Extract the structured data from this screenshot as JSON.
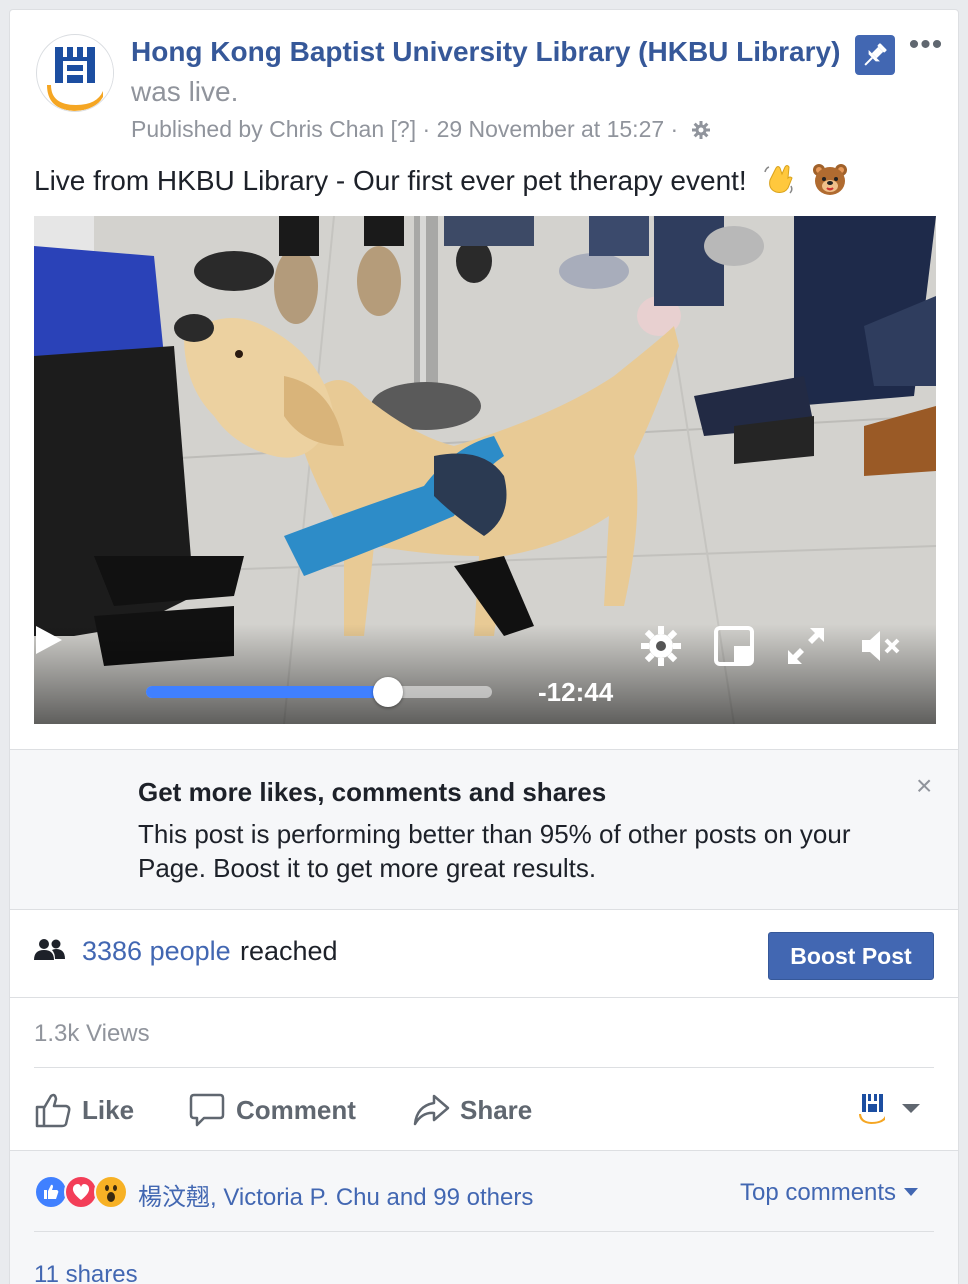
{
  "post": {
    "page_name": "Hong Kong Baptist University Library (HKBU Library)",
    "status": "was live.",
    "published_by": "Published by Chris Chan",
    "help_marker": "[?]",
    "separator": "·",
    "timestamp": "29 November at 15:27",
    "text": "Live from HKBU Library - Our first ever pet therapy event!",
    "emojis": [
      "waving-hand",
      "bear-face"
    ]
  },
  "video": {
    "time_remaining": "-12:44",
    "progress_percent": 70,
    "muted": true
  },
  "boost_panel": {
    "title": "Get more likes, comments and shares",
    "description": "This post is performing better than 95% of other posts on your Page. Boost it to get more great results.",
    "close": "×"
  },
  "reach": {
    "count": "3386 people",
    "label": "reached",
    "boost_button": "Boost Post"
  },
  "views": "1.3k Views",
  "actions": {
    "like": "Like",
    "comment": "Comment",
    "share": "Share"
  },
  "reactions": {
    "types": [
      "like",
      "love",
      "wow"
    ],
    "summary": "楊汶翹, Victoria P. Chu and 99 others",
    "sort_label": "Top comments"
  },
  "shares": "11 shares",
  "colors": {
    "link_blue": "#365899",
    "action_blue": "#4267b2",
    "progress_blue": "#4080ff",
    "love_red": "#f33e58",
    "wow_yellow": "#f7b125"
  }
}
